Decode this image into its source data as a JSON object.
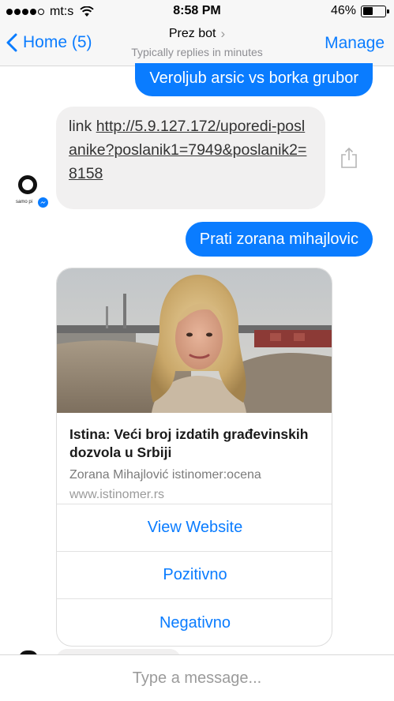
{
  "status_bar": {
    "carrier": "mt:s",
    "time": "8:58 PM",
    "battery_percent": "46%",
    "battery_level": 0.46
  },
  "nav": {
    "back_label": "Home (5)",
    "title": "Prez bot",
    "subtitle": "Typically replies in minutes",
    "action_label": "Manage"
  },
  "messages": [
    {
      "from": "user",
      "text": "Veroljub arsic vs borka grubor"
    },
    {
      "from": "bot",
      "prefix": "link ",
      "link_text": "http://5.9.127.172/uporedi-poslanike?poslanik1=7949&poslanik2=8158"
    },
    {
      "from": "user",
      "text": "Prati zorana mihajlovic"
    }
  ],
  "bot": {
    "avatar_text": "samo pi"
  },
  "card": {
    "title": "Istina: Veći broj izdatih građevinskih dozvola u Srbiji",
    "description": "Zorana Mihajlović istinomer:ocena",
    "domain": "www.istinomer.rs",
    "buttons": [
      "View Website",
      "Pozitivno",
      "Negativno"
    ]
  },
  "composer": {
    "placeholder": "Type a message..."
  },
  "colors": {
    "accent": "#0a7cff",
    "incoming_bubble": "#f1f0f0",
    "bar_background": "#f7f7f7"
  }
}
